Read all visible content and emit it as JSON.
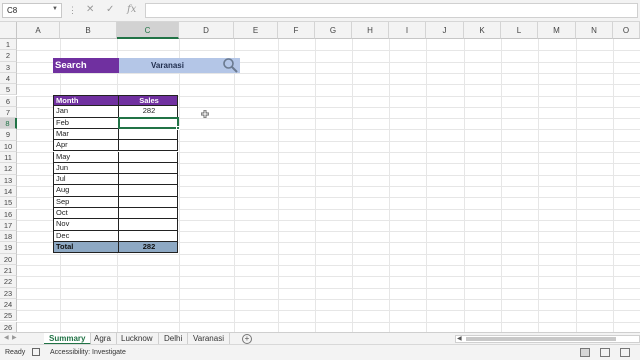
{
  "formula_bar": {
    "name_box": "C8",
    "fx": "fx",
    "cancel": "✕",
    "enter": "✓",
    "value": ""
  },
  "columns": [
    "A",
    "B",
    "C",
    "D",
    "E",
    "F",
    "G",
    "H",
    "I",
    "J",
    "K",
    "L",
    "M",
    "N",
    "O"
  ],
  "selected_column": "C",
  "rows": [
    "1",
    "2",
    "3",
    "4",
    "5",
    "6",
    "7",
    "8",
    "9",
    "10",
    "11",
    "12",
    "13",
    "14",
    "15",
    "16",
    "17",
    "18",
    "19",
    "20",
    "21",
    "22",
    "23",
    "24",
    "25",
    "26"
  ],
  "selected_row": "8",
  "search": {
    "label": "Search",
    "value": "Varanasi"
  },
  "table": {
    "headers": [
      "Month",
      "Sales"
    ],
    "rows": [
      {
        "month": "Jan",
        "sales": "282"
      },
      {
        "month": "Feb",
        "sales": ""
      },
      {
        "month": "Mar",
        "sales": ""
      },
      {
        "month": "Apr",
        "sales": ""
      },
      {
        "month": "May",
        "sales": ""
      },
      {
        "month": "Jun",
        "sales": ""
      },
      {
        "month": "Jul",
        "sales": ""
      },
      {
        "month": "Aug",
        "sales": ""
      },
      {
        "month": "Sep",
        "sales": ""
      },
      {
        "month": "Oct",
        "sales": ""
      },
      {
        "month": "Nov",
        "sales": ""
      },
      {
        "month": "Dec",
        "sales": ""
      }
    ],
    "total_label": "Total",
    "total_value": "282"
  },
  "sheets": [
    "Summary",
    "Agra",
    "Lucknow",
    "Delhi",
    "Varanasi"
  ],
  "active_sheet": "Summary",
  "add_sheet": "+",
  "status": {
    "ready": "Ready",
    "accessibility": "Accessibility: Investigate"
  },
  "colors": {
    "accent": "#217346",
    "header_purple": "#7030a0",
    "search_blue": "#b4c6e7",
    "total_blue": "#8ea9c4"
  }
}
